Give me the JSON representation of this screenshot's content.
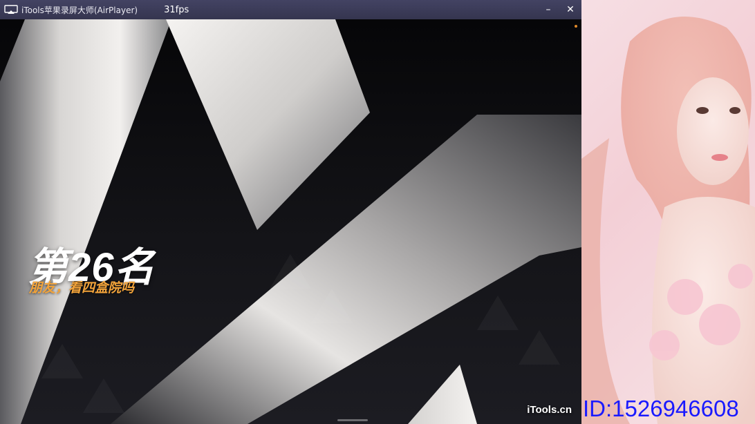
{
  "window": {
    "title": "iTools苹果录屏大师(AirPlayer)",
    "fps": "31fps",
    "minimize_label": "–",
    "close_label": "✕"
  },
  "game": {
    "rank_text": "第26名",
    "subtitle": "朋友，看四盒院吗",
    "watermark": "iTools.cn"
  },
  "overlay": {
    "id_text": "ID:1526946608"
  },
  "colors": {
    "titlebar": "#3b3b58",
    "subtitle": "#f2a33a",
    "id_text": "#1a1aff",
    "side_panel": "#f3cfd6"
  },
  "icons": [
    "airplay-icon",
    "minimize-icon",
    "close-icon"
  ]
}
